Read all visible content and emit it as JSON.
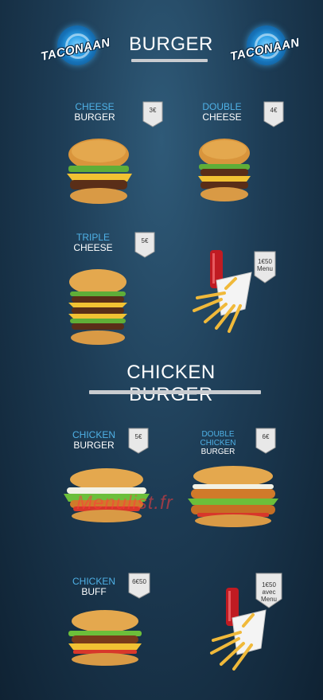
{
  "logo_text": "TACONAAN",
  "sections": {
    "burger_title": "BURGER",
    "chicken_title": "CHICKEN BURGER"
  },
  "items": [
    {
      "line1": "CHEESE",
      "line2": "BURGER",
      "price": "3€"
    },
    {
      "line1": "DOUBLE",
      "line2": "CHEESE",
      "price": "4€"
    },
    {
      "line1": "TRIPLE",
      "line2": "CHEESE",
      "price": "5€"
    },
    {
      "line1": "",
      "line2": "",
      "price": "1€50 Menu"
    },
    {
      "line1": "CHICKEN",
      "line2": "BURGER",
      "price": "5€"
    },
    {
      "line1": "DOUBLE CHICKEN",
      "line2": "BURGER",
      "price": "6€"
    },
    {
      "line1": "CHICKEN",
      "line2": "BUFF",
      "price": "6€50"
    },
    {
      "line1": "",
      "line2": "",
      "price": "1€50 avec Menu"
    }
  ],
  "watermark": "Menulist.fr",
  "colors": {
    "accent": "#4fb1e6",
    "background": "#1d3c55"
  }
}
